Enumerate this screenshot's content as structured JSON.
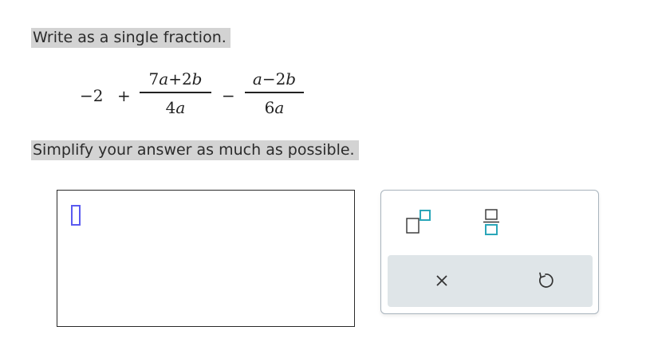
{
  "question": {
    "instruction": "Write as a single fraction.",
    "expression": {
      "lead_term": "−2",
      "plus": "+",
      "minus": "−",
      "fraction_1": {
        "numerator": [
          "7",
          "a",
          "+2",
          "b"
        ],
        "denominator": [
          "4",
          "a"
        ]
      },
      "fraction_2": {
        "numerator": [
          "a",
          "−2",
          "b"
        ],
        "denominator": [
          "6",
          "a"
        ]
      }
    },
    "hint": "Simplify your answer as much as possible."
  },
  "answer": {
    "value": ""
  },
  "palette": {
    "buttons": [
      {
        "icon": "exponent-icon"
      },
      {
        "icon": "fraction-icon"
      },
      {
        "icon": "clear-icon"
      },
      {
        "icon": "undo-icon"
      }
    ],
    "accent_color": "#2aa6b9"
  }
}
